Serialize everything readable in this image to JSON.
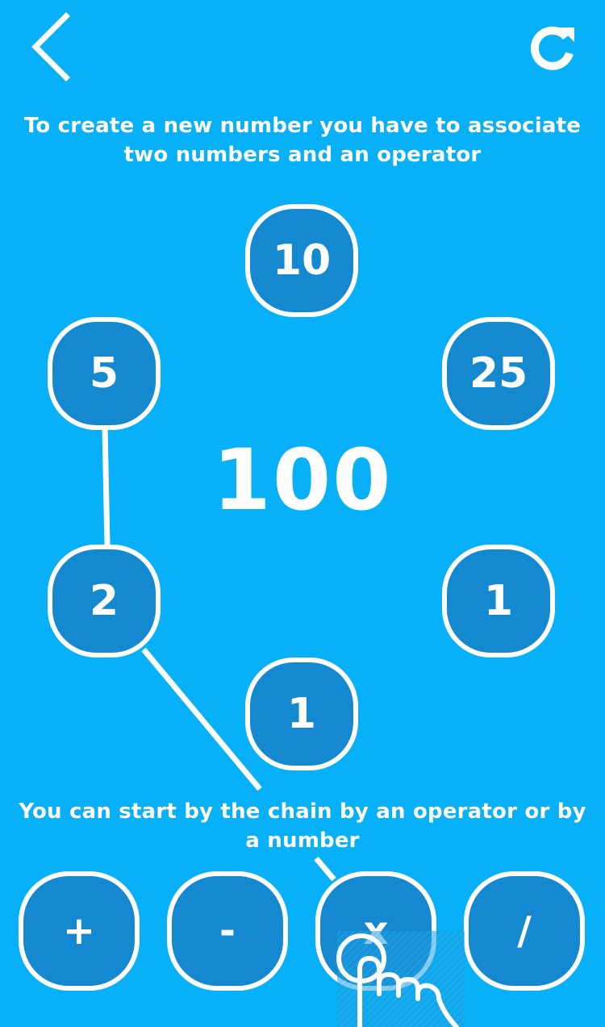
{
  "toolbar": {
    "back_icon": "chevron-left-icon",
    "reload_icon": "reload-icon"
  },
  "hints": {
    "top_line1": "To create a new number you have to associate",
    "top_line2": "two numbers and an operator",
    "bottom_line1": "You can start by the chain by an operator or by",
    "bottom_line2": "a number"
  },
  "target": "100",
  "numbers": {
    "top": "10",
    "upper_left": "5",
    "upper_right": "25",
    "lower_left": "2",
    "lower_right": "1",
    "bottom": "1"
  },
  "operators": {
    "plus": "+",
    "minus": "-",
    "times": "x",
    "divide": "/"
  },
  "tutorial": {
    "hand_icon": "pointing-hand-icon"
  },
  "colors": {
    "background": "#08b0f7",
    "tile_fill": "#1489d0",
    "outline": "#ffffff"
  }
}
